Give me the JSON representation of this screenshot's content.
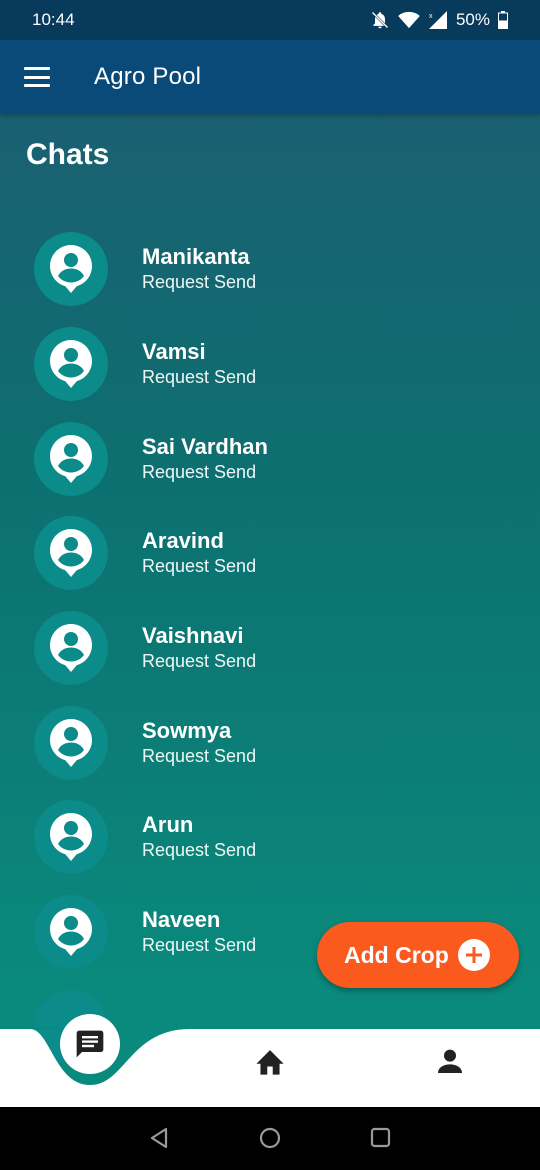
{
  "status_bar": {
    "time": "10:44",
    "battery": "50%"
  },
  "app_bar": {
    "title": "Agro Pool"
  },
  "page": {
    "title": "Chats"
  },
  "chats": [
    {
      "name": "Manikanta",
      "status": "Request Send"
    },
    {
      "name": "Vamsi",
      "status": "Request Send"
    },
    {
      "name": "Sai Vardhan",
      "status": "Request Send"
    },
    {
      "name": "Aravind",
      "status": "Request Send"
    },
    {
      "name": "Vaishnavi",
      "status": "Request Send"
    },
    {
      "name": "Sowmya",
      "status": "Request Send"
    },
    {
      "name": "Arun",
      "status": "Request Send"
    },
    {
      "name": "Naveen",
      "status": "Request Send"
    }
  ],
  "fab": {
    "label": "Add Crop"
  },
  "bottom_nav": {
    "items": [
      "chat-icon",
      "home-icon",
      "person-icon"
    ],
    "active": "chat-icon"
  },
  "colors": {
    "app_bar": "#0a4a78",
    "avatar": "#0b8b89",
    "fab": "#fa5a1e"
  }
}
